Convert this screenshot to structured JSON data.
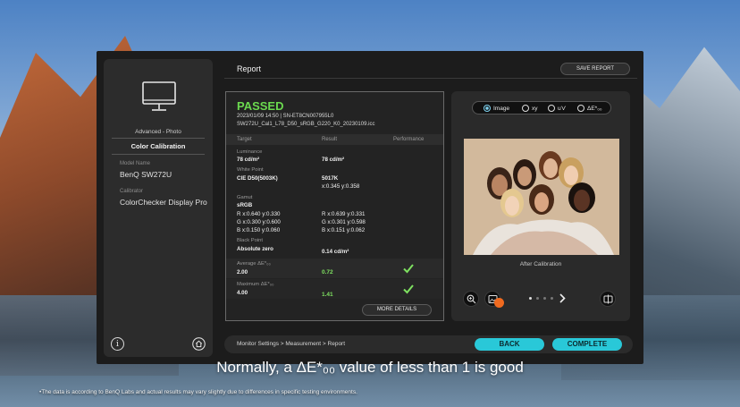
{
  "sidebar": {
    "mode": "Advanced - Photo",
    "title": "Color Calibration",
    "model_label": "Model Name",
    "model_value": "BenQ SW272U",
    "calibrator_label": "Calibrator",
    "calibrator_value": "ColorChecker Display Pro"
  },
  "header": {
    "title": "Report",
    "save_label": "SAVE REPORT"
  },
  "report": {
    "status": "PASSED",
    "datetime": "2023/01/09 14:50 | SN-ET8CN007955L0",
    "file": "SW272U_Cal1_L78_D50_sRGB_G220_K0_20230109.icc",
    "columns": [
      "Target",
      "Result",
      "Performance"
    ],
    "luminance": {
      "label": "Luminance",
      "target": "78 cd/m²",
      "result": "78 cd/m²"
    },
    "white_point": {
      "label": "White Point",
      "target": "CIE D50(5003K)",
      "result_k": "5017K",
      "result_xy": "x:0.345 y:0.358"
    },
    "gamut": {
      "label": "Gamut",
      "name": "sRGB",
      "target_r": "R x:0.640 y:0.330",
      "target_g": "G x:0.300 y:0.600",
      "target_b": "B x:0.150 y:0.060",
      "result_r": "R x:0.639 y:0.331",
      "result_g": "G x:0.301 y:0.598",
      "result_b": "B x:0.151 y:0.062"
    },
    "black_point": {
      "label": "Black Point",
      "target": "Absolute zero",
      "result": "0.14 cd/m²"
    },
    "avg_de": {
      "label": "Average ΔE*₀₀",
      "target": "2.00",
      "result": "0.72"
    },
    "max_de": {
      "label": "Maximum ΔE*₀₀",
      "target": "4.00",
      "result": "1.41"
    },
    "more_label": "MORE DETAILS"
  },
  "image_panel": {
    "options": [
      "Image",
      "xy",
      "u'v'",
      "ΔE*₀₀"
    ],
    "selected": "Image",
    "caption": "After Calibration"
  },
  "footer": {
    "breadcrumb": "Monitor Settings >   Measurement >   Report",
    "back_label": "BACK",
    "complete_label": "COMPLETE"
  },
  "overlay": {
    "caption": "Normally, a ΔE*₀₀ value of less than 1 is good",
    "footnote": "•The data is according to BenQ Labs and actual results may vary slightly due to differences in specific testing environments."
  },
  "colors": {
    "accent": "#29c8d8",
    "passed": "#6bd94f",
    "badge": "#f06a1f"
  }
}
